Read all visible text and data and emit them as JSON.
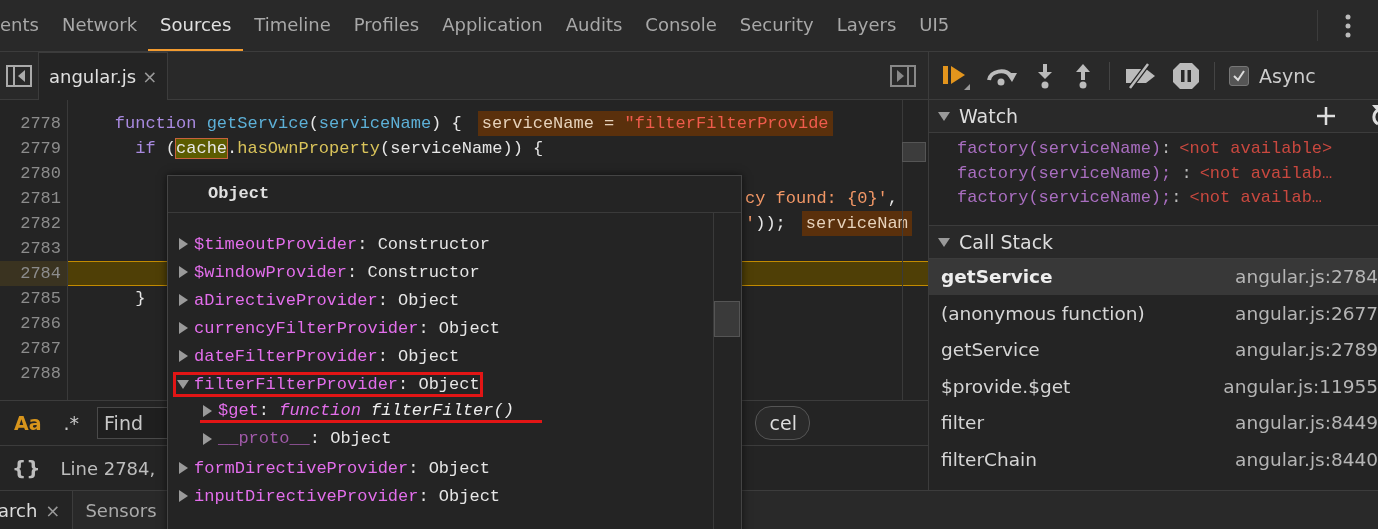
{
  "panel_tabs": [
    {
      "label": "ents",
      "selected": false
    },
    {
      "label": "Network",
      "selected": false
    },
    {
      "label": "Sources",
      "selected": true
    },
    {
      "label": "Timeline",
      "selected": false
    },
    {
      "label": "Profiles",
      "selected": false
    },
    {
      "label": "Application",
      "selected": false
    },
    {
      "label": "Audits",
      "selected": false
    },
    {
      "label": "Console",
      "selected": false
    },
    {
      "label": "Security",
      "selected": false
    },
    {
      "label": "Layers",
      "selected": false
    },
    {
      "label": "UI5",
      "selected": false
    }
  ],
  "editor": {
    "file_tab": {
      "name": "angular.js",
      "close": "×"
    },
    "lines": [
      {
        "number": "2778",
        "current": false,
        "kind": "code",
        "tokens": [
          {
            "kind": "kw",
            "text": "    function "
          },
          {
            "kind": "fn",
            "text": "getService"
          },
          {
            "kind": "plain",
            "text": "("
          },
          {
            "kind": "fn",
            "text": "serviceName"
          },
          {
            "kind": "plain",
            "text": ") {"
          },
          {
            "kind": "inline",
            "text": "serviceName = "
          },
          {
            "kind": "inline-string",
            "text": "\"filterFilterProvide"
          }
        ]
      },
      {
        "number": "2779",
        "current": false,
        "kind": "code",
        "tokens": [
          {
            "kind": "kw",
            "text": "      if "
          },
          {
            "kind": "plain",
            "text": "("
          },
          {
            "kind": "match",
            "text": "cache"
          },
          {
            "kind": "plain",
            "text": "."
          },
          {
            "kind": "method",
            "text": "hasOwnProperty"
          },
          {
            "kind": "plain",
            "text": "(serviceName)) {"
          }
        ]
      },
      {
        "number": "2780",
        "current": false,
        "kind": "code"
      },
      {
        "number": "2781",
        "current": false,
        "kind": "tail",
        "tokens": [
          {
            "kind": "string",
            "text": "cy found: {0}'"
          },
          {
            "kind": "plain",
            "text": ","
          }
        ]
      },
      {
        "number": "2782",
        "current": false,
        "kind": "tail",
        "tokens": [
          {
            "kind": "string",
            "text": "'"
          },
          {
            "kind": "plain",
            "text": "));"
          },
          {
            "kind": "inline",
            "text": "serviceNam"
          }
        ]
      },
      {
        "number": "2783",
        "current": false,
        "kind": "code"
      },
      {
        "number": "2784",
        "current": true,
        "kind": "code"
      },
      {
        "number": "2785",
        "current": false,
        "kind": "code",
        "tokens": [
          {
            "kind": "plain",
            "text": "      }"
          }
        ]
      },
      {
        "number": "2786",
        "current": false,
        "kind": "code"
      },
      {
        "number": "2787",
        "current": false,
        "kind": "code"
      },
      {
        "number": "2788",
        "current": false,
        "kind": "code"
      }
    ]
  },
  "find_bar": {
    "toggles": [
      {
        "label": "Aa",
        "on": true
      },
      {
        "label": ".*",
        "on": false
      }
    ],
    "placeholder": "Find",
    "cancel": "cel"
  },
  "status_bar": {
    "format_icon": "{}",
    "position": "Line 2784,"
  },
  "drawer_tabs": [
    {
      "label": "arch",
      "close": "×",
      "selected": true
    },
    {
      "label": "Sensors",
      "selected": false
    }
  ],
  "popover": {
    "title": "Object",
    "items": [
      {
        "key": "$timeoutProvider",
        "separator": ":",
        "value": "Constructor",
        "expanded": false,
        "highlighted": false
      },
      {
        "key": "$windowProvider",
        "separator": ":",
        "value": "Constructor",
        "expanded": false,
        "highlighted": false
      },
      {
        "key": "aDirectiveProvider",
        "separator": ":",
        "value": "Object",
        "expanded": false,
        "highlighted": false
      },
      {
        "key": "currencyFilterProvider",
        "separator": ":",
        "value": "Object",
        "expanded": false,
        "highlighted": false
      },
      {
        "key": "dateFilterProvider",
        "separator": ":",
        "value": "Object",
        "expanded": false,
        "highlighted": false
      },
      {
        "key": "filterFilterProvider",
        "separator": ":",
        "value": "Object",
        "expanded": true,
        "highlighted": true,
        "children": [
          {
            "kind": "function",
            "key": "$get",
            "separator": ":",
            "value_keyword": "function",
            "value": "filterFilter()",
            "highlighted": true
          },
          {
            "kind": "object",
            "key": "__proto__",
            "separator": ":",
            "value": "Object",
            "highlighted": false
          }
        ]
      },
      {
        "key": "formDirectiveProvider",
        "separator": ":",
        "value": "Object",
        "expanded": false,
        "highlighted": false
      },
      {
        "key": "inputDirectiveProvider",
        "separator": ":",
        "value": "Object",
        "expanded": false,
        "highlighted": false
      }
    ]
  },
  "debugger": {
    "async": {
      "label": "Async",
      "checked": true
    },
    "watch": {
      "title": "Watch",
      "expanded": true,
      "items": [
        {
          "expression": "factory(serviceName)",
          "separator": ":",
          "value": "<not available>"
        },
        {
          "expression": "factory(serviceName);",
          "separator": " :",
          "value": "<not availab…"
        },
        {
          "expression": "factory(serviceName);",
          "separator": ":",
          "value": "<not availab…"
        }
      ]
    },
    "call_stack": {
      "title": "Call Stack",
      "expanded": true,
      "frames": [
        {
          "function": "getService",
          "location": "angular.js:2784",
          "selected": true
        },
        {
          "function": "(anonymous function)",
          "location": "angular.js:2677",
          "selected": false
        },
        {
          "function": "getService",
          "location": "angular.js:2789",
          "selected": false
        },
        {
          "function": "$provide.$get",
          "location": "angular.js:11955",
          "selected": false
        },
        {
          "function": "filter",
          "location": "angular.js:8449",
          "selected": false
        },
        {
          "function": "filterChain",
          "location": "angular.js:8440",
          "selected": false
        }
      ]
    }
  }
}
